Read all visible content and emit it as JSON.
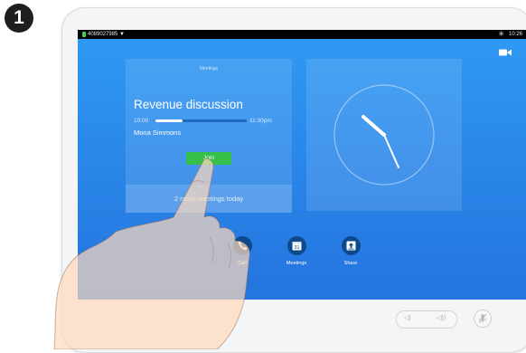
{
  "step_number": "1",
  "status_bar": {
    "number": "4089027985 ▼",
    "time": "10:26"
  },
  "meeting_card": {
    "header": "Meetings",
    "title": "Revenue discussion",
    "start_time": "10:00",
    "end_time": "11:30pm",
    "progress": 0.3,
    "host": "Mona Simmons",
    "join_label": "Join",
    "footer": "2 more meetings today"
  },
  "dock": {
    "call_label": "Call",
    "meetings_label": "Meetings",
    "meetings_date": "31",
    "share_label": "Share"
  },
  "colors": {
    "join": "#36c04a",
    "dock_icon": "#0c4a8c",
    "screen": "#2a88ea"
  },
  "icons": [
    "camera-icon",
    "bluetooth-icon",
    "phone-icon",
    "calendar-icon",
    "share-icon",
    "volume-down-icon",
    "volume-up-icon",
    "mute-icon"
  ]
}
